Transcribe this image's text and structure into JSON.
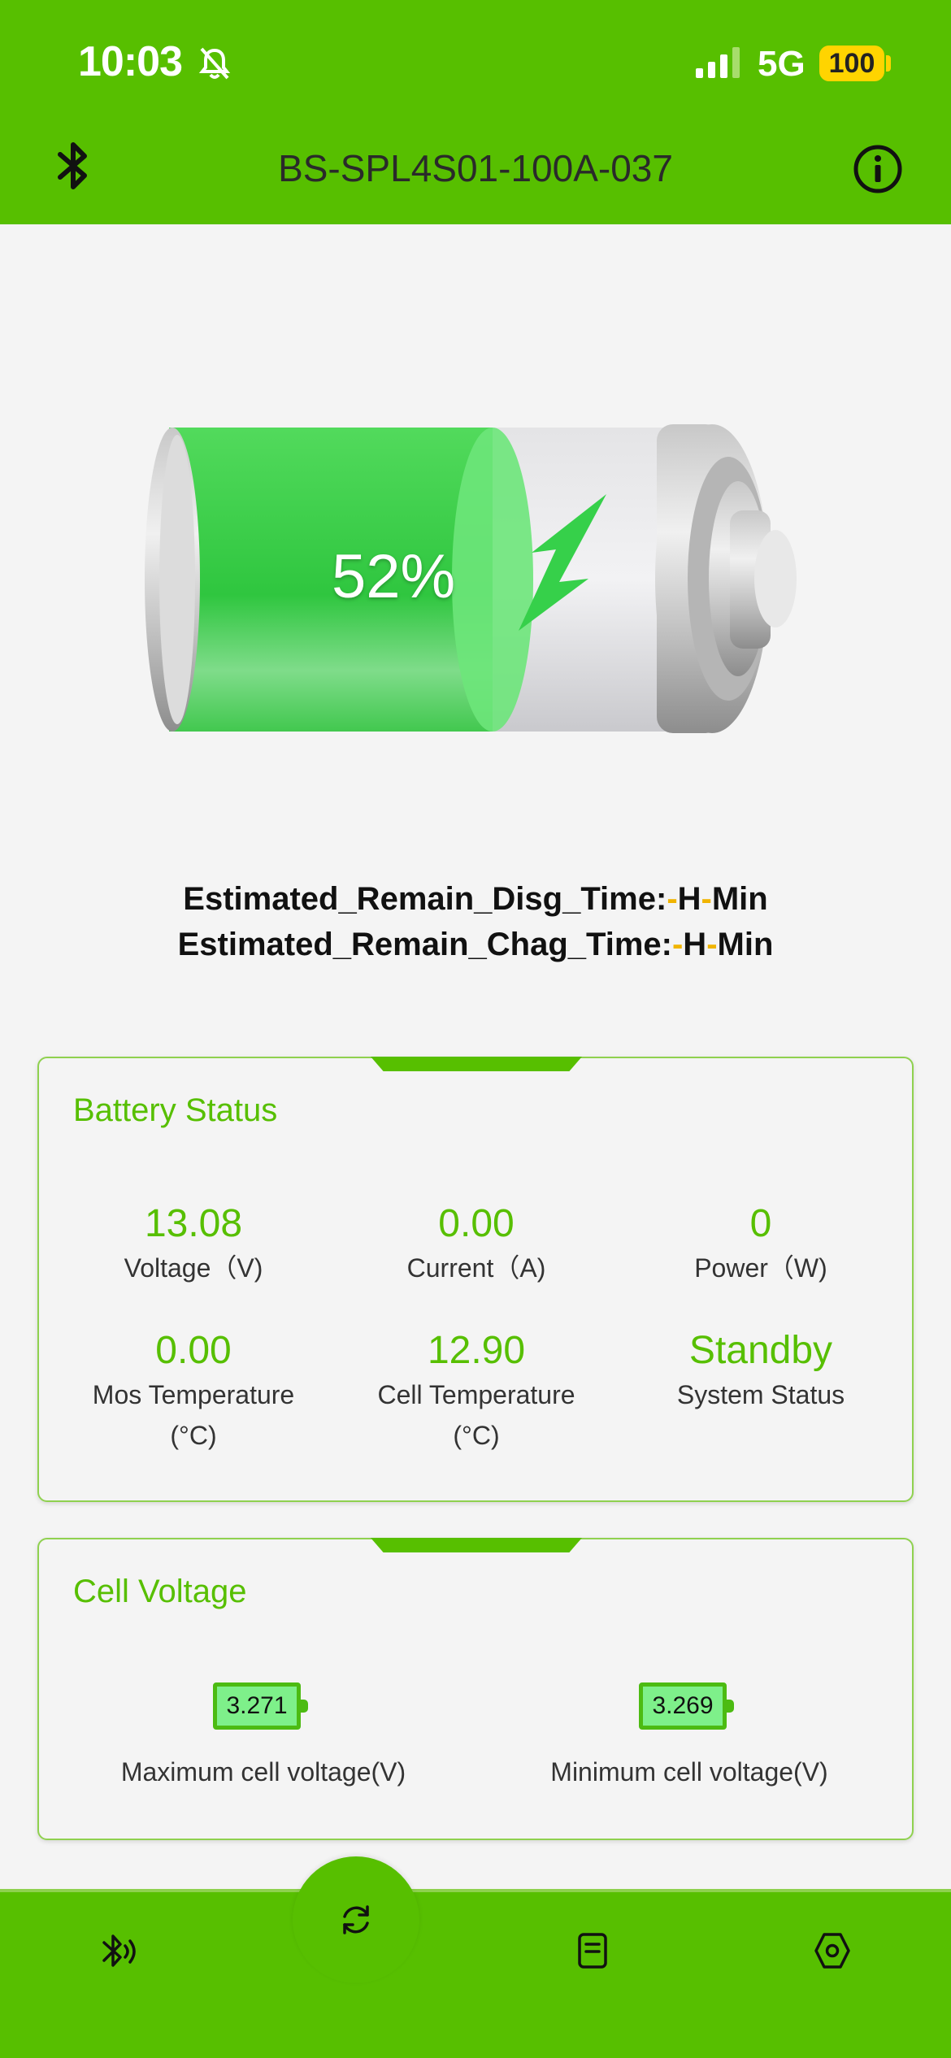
{
  "status_bar": {
    "time": "10:03",
    "network": "5G",
    "battery_level": "100"
  },
  "header": {
    "device_name": "BS-SPL4S01-100A-037"
  },
  "battery": {
    "percent_label": "52%",
    "charge_fraction": 0.52
  },
  "estimates": {
    "disg_label": "Estimated_Remain_Disg_Time:",
    "chag_label": "Estimated_Remain_Chag_Time:",
    "dash": "-",
    "hour_unit": "H",
    "min_unit": "Min"
  },
  "battery_status": {
    "title": "Battery Status",
    "voltage": {
      "value": "13.08",
      "label": "Voltage（V)"
    },
    "current": {
      "value": "0.00",
      "label": "Current（A)"
    },
    "power": {
      "value": "0",
      "label": "Power（W)"
    },
    "mos_temp": {
      "value": "0.00",
      "label": "Mos Temperature",
      "unit": "(°C)"
    },
    "cell_temp": {
      "value": "12.90",
      "label": "Cell Temperature",
      "unit": "(°C)"
    },
    "system_status": {
      "value": "Standby",
      "label": "System Status"
    }
  },
  "cell_voltage": {
    "title": "Cell Voltage",
    "max": {
      "value": "3.271",
      "label": "Maximum cell voltage(V)"
    },
    "min": {
      "value": "3.269",
      "label": "Minimum cell voltage(V)"
    }
  },
  "bottom_nav": {
    "items": [
      "bluetooth-signal-icon",
      "refresh-icon",
      "document-icon",
      "settings-hex-icon"
    ]
  },
  "colors": {
    "accent": "#57bf00",
    "battery_fill": "#3fd04e",
    "warning": "#f0b400"
  }
}
